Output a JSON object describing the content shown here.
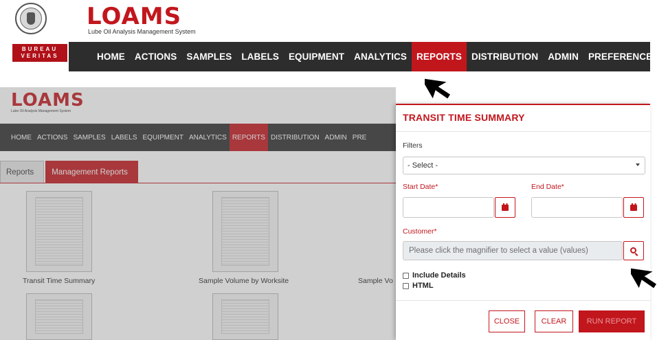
{
  "header": {
    "bv_seal_text": "BUREAU VERITAS 1828",
    "bv_badge_lines": [
      "BUREAU",
      "VERITAS"
    ],
    "logo_word": "LOAMS",
    "logo_tagline": "Lube Oil Analysis Management System",
    "nav_items": [
      "HOME",
      "ACTIONS",
      "SAMPLES",
      "LABELS",
      "EQUIPMENT",
      "ANALYTICS",
      "REPORTS",
      "DISTRIBUTION",
      "ADMIN",
      "PREFERENCES"
    ],
    "active_nav": "REPORTS"
  },
  "background_page": {
    "logo_word": "LOAMS",
    "logo_tagline": "Lube Oil Analysis Management System",
    "nav_items": [
      "HOME",
      "ACTIONS",
      "SAMPLES",
      "LABELS",
      "EQUIPMENT",
      "ANALYTICS",
      "REPORTS",
      "DISTRIBUTION",
      "ADMIN",
      "PRE"
    ],
    "tabs": [
      "Reports",
      "Management Reports"
    ],
    "report_labels": [
      "Transit Time Summary",
      "Sample Volume by Worksite",
      "Sample Vo"
    ]
  },
  "modal": {
    "title": "TRANSIT TIME SUMMARY",
    "filters_label": "Filters",
    "filters_selected": "- Select -",
    "start_date_label": "Start Date*",
    "end_date_label": "End Date*",
    "customer_label": "Customer*",
    "customer_placeholder": "Please click the magnifier to select a value (values)",
    "include_details_label": "Include Details",
    "html_label": "HTML",
    "close_label": "CLOSE",
    "clear_label": "CLEAR",
    "run_label": "RUN REPORT"
  },
  "colors": {
    "brand_red": "#c2161d",
    "nav_dark": "#2d2d2d"
  }
}
